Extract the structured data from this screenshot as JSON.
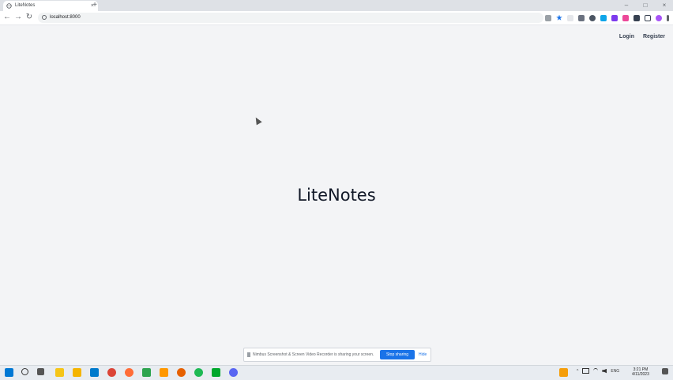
{
  "browser": {
    "tab_title": "LiteNotes",
    "tab_close": "×",
    "new_tab": "+",
    "url": "localhost:8000",
    "nav": {
      "back": "←",
      "forward": "→",
      "reload": "↻"
    },
    "window_controls": {
      "minimize": "–",
      "maximize": "□",
      "close": "×"
    },
    "extensions": [
      "share-icon",
      "star-icon",
      "extension-icon",
      "extension-icon",
      "extension-icon",
      "extension-icon",
      "extension-icon",
      "extension-icon",
      "puzzle-icon",
      "sidepanel-icon",
      "profile-avatar",
      "menu-icon"
    ]
  },
  "page": {
    "nav": {
      "login": "Login",
      "register": "Register"
    },
    "hero_title": "LiteNotes"
  },
  "share_banner": {
    "text": "Nimbus Screenshot & Screen Video Recorder is sharing your screen.",
    "stop_label": "Stop sharing",
    "hide_label": "Hide"
  },
  "taskbar": {
    "apps": [
      "windows-start-icon",
      "search-icon",
      "task-view-icon",
      "sticky-notes-icon",
      "file-explorer-icon",
      "vscode-icon",
      "chrome-icon",
      "postman-icon",
      "git-icon",
      "sublime-icon",
      "firefox-icon",
      "spotify-icon",
      "evernote-icon",
      "discord-icon"
    ],
    "tray_lang": "ENG",
    "time": "3:21 PM",
    "date": "4/11/2023"
  },
  "colors": {
    "page_bg": "#f3f4f6",
    "accent": "#1a73e8"
  }
}
